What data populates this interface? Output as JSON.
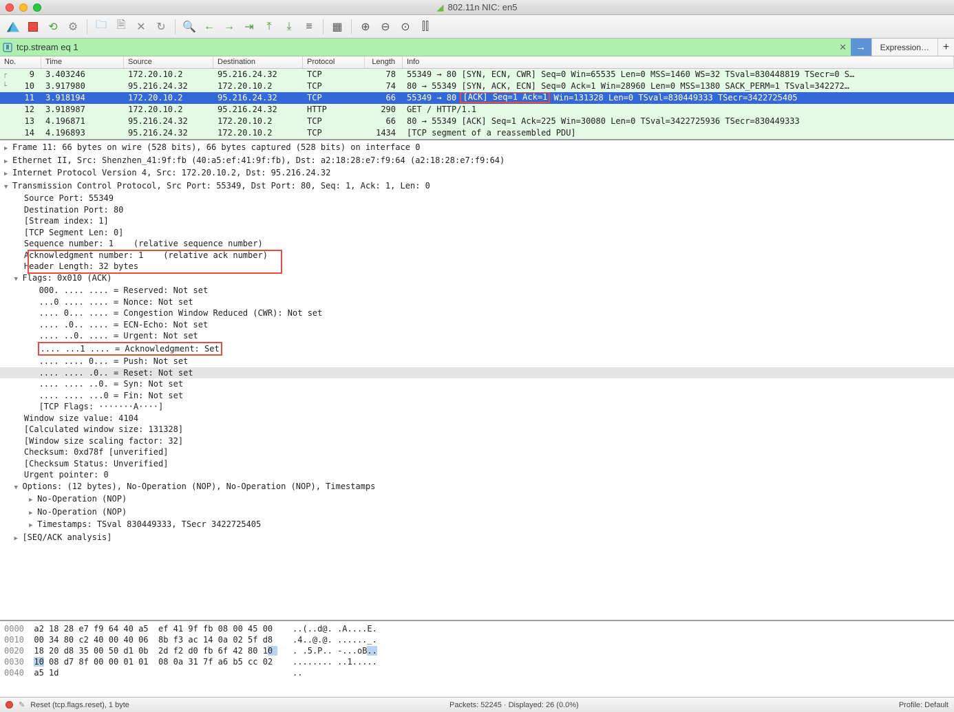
{
  "window": {
    "title": "802.11n NIC: en5"
  },
  "filter": {
    "value": "tcp.stream eq 1",
    "expression_label": "Expression…"
  },
  "columns": {
    "no": "No.",
    "time": "Time",
    "src": "Source",
    "dst": "Destination",
    "proto": "Protocol",
    "len": "Length",
    "info": "Info"
  },
  "packets": [
    {
      "no": "9",
      "time": "3.403246",
      "src": "172.20.10.2",
      "dst": "95.216.24.32",
      "proto": "TCP",
      "len": "78",
      "info": "55349 → 80 [SYN, ECN, CWR] Seq=0 Win=65535 Len=0 MSS=1460 WS=32 TSval=830448819 TSecr=0 S…"
    },
    {
      "no": "10",
      "time": "3.917980",
      "src": "95.216.24.32",
      "dst": "172.20.10.2",
      "proto": "TCP",
      "len": "74",
      "info": "80 → 55349 [SYN, ACK, ECN] Seq=0 Ack=1 Win=28960 Len=0 MSS=1380 SACK_PERM=1 TSval=342272…"
    },
    {
      "no": "11",
      "time": "3.918194",
      "src": "172.20.10.2",
      "dst": "95.216.24.32",
      "proto": "TCP",
      "len": "66",
      "info_pre": "55349 → 80 ",
      "info_box": "[ACK] Seq=1 Ack=1",
      "info_post": " Win=131328 Len=0 TSval=830449333 TSecr=3422725405",
      "selected": true
    },
    {
      "no": "12",
      "time": "3.918987",
      "src": "172.20.10.2",
      "dst": "95.216.24.32",
      "proto": "HTTP",
      "len": "290",
      "info": "GET / HTTP/1.1"
    },
    {
      "no": "13",
      "time": "4.196871",
      "src": "95.216.24.32",
      "dst": "172.20.10.2",
      "proto": "TCP",
      "len": "66",
      "info": "80 → 55349 [ACK] Seq=1 Ack=225 Win=30080 Len=0 TSval=3422725936 TSecr=830449333"
    },
    {
      "no": "14",
      "time": "4.196893",
      "src": "95.216.24.32",
      "dst": "172.20.10.2",
      "proto": "TCP",
      "len": "1434",
      "info": "[TCP segment of a reassembled PDU]"
    }
  ],
  "details": {
    "frame": "Frame 11: 66 bytes on wire (528 bits), 66 bytes captured (528 bits) on interface 0",
    "eth": "Ethernet II, Src: Shenzhen_41:9f:fb (40:a5:ef:41:9f:fb), Dst: a2:18:28:e7:f9:64 (a2:18:28:e7:f9:64)",
    "ip": "Internet Protocol Version 4, Src: 172.20.10.2, Dst: 95.216.24.32",
    "tcp": "Transmission Control Protocol, Src Port: 55349, Dst Port: 80, Seq: 1, Ack: 1, Len: 0",
    "srcport": "Source Port: 55349",
    "dstport": "Destination Port: 80",
    "streamidx": "[Stream index: 1]",
    "seglen": "[TCP Segment Len: 0]",
    "seqnum": "Sequence number: 1    (relative sequence number)",
    "acknum": "Acknowledgment number: 1    (relative ack number)",
    "hdrlen": "Header Length: 32 bytes",
    "flags": "Flags: 0x010 (ACK)",
    "f_res": "000. .... .... = Reserved: Not set",
    "f_nonce": "...0 .... .... = Nonce: Not set",
    "f_cwr": ".... 0... .... = Congestion Window Reduced (CWR): Not set",
    "f_ece": ".... .0.. .... = ECN-Echo: Not set",
    "f_urg": ".... ..0. .... = Urgent: Not set",
    "f_ack": ".... ...1 .... = Acknowledgment: Set",
    "f_psh": ".... .... 0... = Push: Not set",
    "f_rst": ".... .... .0.. = Reset: Not set",
    "f_syn": ".... .... ..0. = Syn: Not set",
    "f_fin": ".... .... ...0 = Fin: Not set",
    "f_str": "[TCP Flags: ·······A····]",
    "winsize": "Window size value: 4104",
    "winsize_calc": "[Calculated window size: 131328]",
    "winsize_sf": "[Window size scaling factor: 32]",
    "checksum": "Checksum: 0xd78f [unverified]",
    "checksum_st": "[Checksum Status: Unverified]",
    "urgent": "Urgent pointer: 0",
    "options": "Options: (12 bytes), No-Operation (NOP), No-Operation (NOP), Timestamps",
    "nop1": "No-Operation (NOP)",
    "nop2": "No-Operation (NOP)",
    "ts": "Timestamps: TSval 830449333, TSecr 3422725405",
    "seqack": "[SEQ/ACK analysis]"
  },
  "hex": {
    "lines": [
      {
        "off": "0000",
        "hex": "a2 18 28 e7 f9 64 40 a5  ef 41 9f fb 08 00 45 00",
        "asc": "..(..d@. .A....E."
      },
      {
        "off": "0010",
        "hex": "00 34 80 c2 40 00 40 06  8b f3 ac 14 0a 02 5f d8",
        "asc": ".4..@.@. ......_."
      },
      {
        "off": "0020",
        "hex": "18 20 d8 35 00 50 d1 0b  2d f2 d0 fb 6f 42 80 10",
        "asc": ". .5.P.. -...oB.."
      },
      {
        "off": "0030",
        "hex": "10 08 d7 8f 00 00 01 01  08 0a 31 7f a6 b5 cc 02",
        "asc": "........ ..1....."
      },
      {
        "off": "0040",
        "hex": "a5 1d",
        "asc": ".."
      }
    ]
  },
  "status": {
    "left": "Reset (tcp.flags.reset), 1 byte",
    "center": "Packets: 52245 · Displayed: 26 (0.0%)",
    "right": "Profile: Default"
  }
}
